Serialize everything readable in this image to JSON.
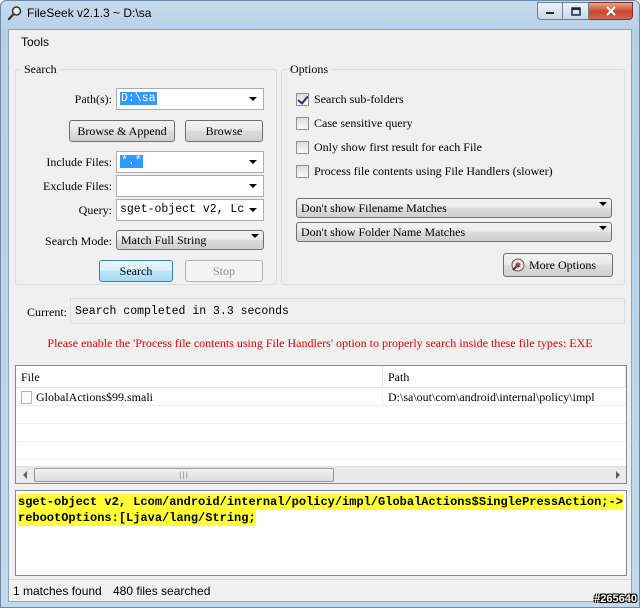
{
  "window": {
    "title": "FileSeek v2.1.3 ~ D:\\sa",
    "icon": "magnifier-icon"
  },
  "menu": {
    "items": [
      "Tools"
    ]
  },
  "search": {
    "group_title": "Search",
    "path_label": "Path(s):",
    "path_value": "D:\\sa",
    "browse_append_label": "Browse & Append",
    "browse_label": "Browse",
    "include_label": "Include Files:",
    "include_value": "*.*",
    "exclude_label": "Exclude Files:",
    "exclude_value": "",
    "query_label": "Query:",
    "query_value": "sget-object v2, Lc",
    "mode_label": "Search Mode:",
    "mode_value": "Match Full String",
    "search_button": "Search",
    "stop_button": "Stop"
  },
  "options": {
    "group_title": "Options",
    "checkboxes": [
      {
        "label": "Search sub-folders",
        "checked": true
      },
      {
        "label": "Case sensitive query",
        "checked": false
      },
      {
        "label": "Only show first result for each File",
        "checked": false
      },
      {
        "label": "Process file contents using File Handlers (slower)",
        "checked": false
      }
    ],
    "filename_match_value": "Don't show Filename Matches",
    "folder_match_value": "Don't show Folder Name Matches",
    "more_options_label": "More Options"
  },
  "current": {
    "label": "Current:",
    "value": "Search completed in 3.3 seconds"
  },
  "warning": "Please enable the 'Process file contents using File Handlers' option to properly search inside these file types: EXE",
  "results": {
    "columns": [
      "File",
      "Path"
    ],
    "rows": [
      {
        "file": "GlobalActions$99.smali",
        "path": "D:\\sa\\out\\com\\android\\internal\\policy\\impl"
      }
    ]
  },
  "preview": {
    "lines": [
      "sget-object v2, Lcom/android/internal/policy/impl/GlobalActions$SinglePressAction;->",
      "rebootOptions:[Ljava/lang/String;"
    ],
    "highlight_color": "#ffff33"
  },
  "status": {
    "matches": "1 matches found",
    "files": "480 files searched"
  },
  "watermark": "#265640",
  "colors": {
    "warning": "#e00000",
    "selection": "#3399ff"
  }
}
